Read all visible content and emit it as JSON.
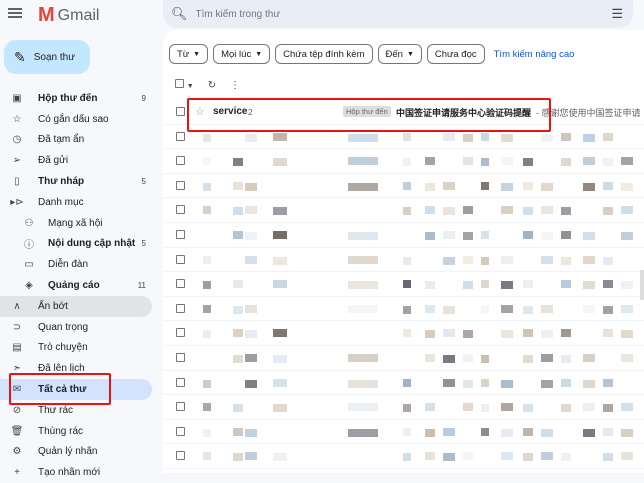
{
  "app": {
    "logo_text": "Gmail"
  },
  "compose": {
    "label": "Soạn thư"
  },
  "search": {
    "placeholder": "Tìm kiếm trong thư"
  },
  "sidebar": {
    "items": [
      {
        "label": "Hộp thư đến",
        "count": "9",
        "bold": true
      },
      {
        "label": "Có gắn dấu sao"
      },
      {
        "label": "Đã tạm ẩn"
      },
      {
        "label": "Đã gửi"
      },
      {
        "label": "Thư nháp",
        "count": "5",
        "bold": true
      },
      {
        "label": "Danh mục"
      },
      {
        "label": "Mạng xã hội"
      },
      {
        "label": "Nội dung cập nhật",
        "count": "5",
        "bold": true
      },
      {
        "label": "Diễn đàn"
      },
      {
        "label": "Quảng cáo",
        "count": "11",
        "bold": true
      },
      {
        "label": "Ẩn bớt"
      },
      {
        "label": "Quan trọng"
      },
      {
        "label": "Trò chuyện"
      },
      {
        "label": "Đã lên lịch"
      },
      {
        "label": "Tất cả thư",
        "bold": true
      },
      {
        "label": "Thư rác"
      },
      {
        "label": "Thùng rác"
      },
      {
        "label": "Quản lý nhãn"
      },
      {
        "label": "Tạo nhãn mới"
      }
    ]
  },
  "filters": {
    "from": "Từ",
    "any_time": "Mọi lúc",
    "has_attachment": "Chứa tệp đính kèm",
    "to": "Đến",
    "unread": "Chưa đọc",
    "advanced": "Tìm kiếm nâng cao"
  },
  "email": {
    "sender": "service",
    "count": "2",
    "label": "Hộp thư đến",
    "subject": "中国签证申请服务中心验证码提醒",
    "snippet": "- 感谢您使用中国签证申请"
  },
  "colors": {
    "accent": "#0b57d0",
    "compose_bg": "#c2e7ff",
    "active_bg": "#d3e3fd",
    "highlight": "#e11111"
  }
}
